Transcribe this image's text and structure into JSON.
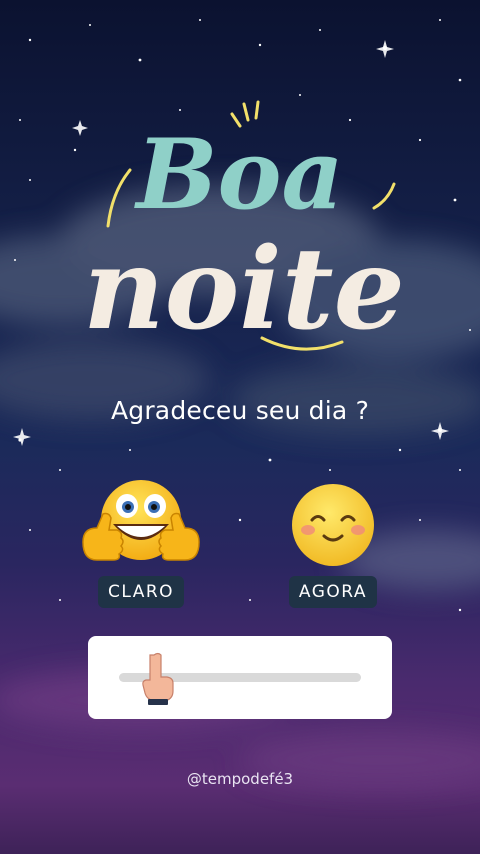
{
  "logo": {
    "line1": "Boa",
    "line2": "noite"
  },
  "question": "Agradeceu seu dia ?",
  "options": [
    {
      "label": "CLARO",
      "emoji": "grinning-thumbs-up-emoji"
    },
    {
      "label": "AGORA",
      "emoji": "blushing-smile-emoji"
    }
  ],
  "slider": {
    "value": 0.12,
    "icon": "pointing-hand-icon"
  },
  "handle": "@tempodefé3",
  "colors": {
    "logo_top": "#8fd0c8",
    "logo_bottom": "#f4ece2",
    "accent_yellow": "#f2e06a",
    "pill_bg": "#1f3346"
  }
}
